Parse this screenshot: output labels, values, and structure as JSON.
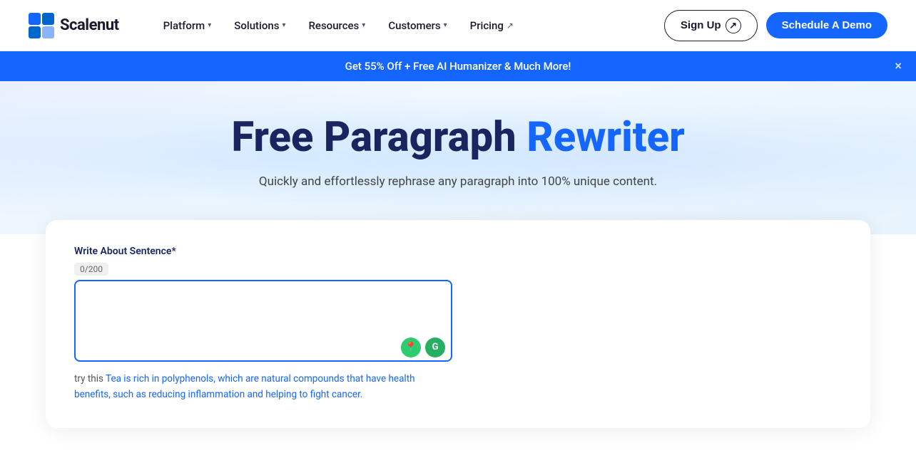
{
  "navbar": {
    "logo_text": "Scalenut",
    "nav_items": [
      {
        "label": "Platform",
        "has_chevron": true,
        "has_ext": false
      },
      {
        "label": "Solutions",
        "has_chevron": true,
        "has_ext": false
      },
      {
        "label": "Resources",
        "has_chevron": true,
        "has_ext": false
      },
      {
        "label": "Customers",
        "has_chevron": true,
        "has_ext": false
      },
      {
        "label": "Pricing",
        "has_chevron": false,
        "has_ext": true
      }
    ],
    "signup_label": "Sign Up",
    "demo_label": "Schedule A Demo"
  },
  "banner": {
    "text": "Get 55% Off + Free AI Humanizer & Much More!",
    "close_label": "×"
  },
  "hero": {
    "title_dark": "Free Paragraph",
    "title_blue": "Rewriter",
    "subtitle": "Quickly and effortlessly rephrase any paragraph into 100% unique content."
  },
  "tool": {
    "field_label": "Write About Sentence*",
    "char_count": "0",
    "char_max": "/200",
    "textarea_placeholder": "",
    "try_prefix": "try this",
    "try_sample": "Tea is rich in polyphenols, which are natural compounds that have health benefits, such as reducing inflammation and helping to fight cancer."
  }
}
